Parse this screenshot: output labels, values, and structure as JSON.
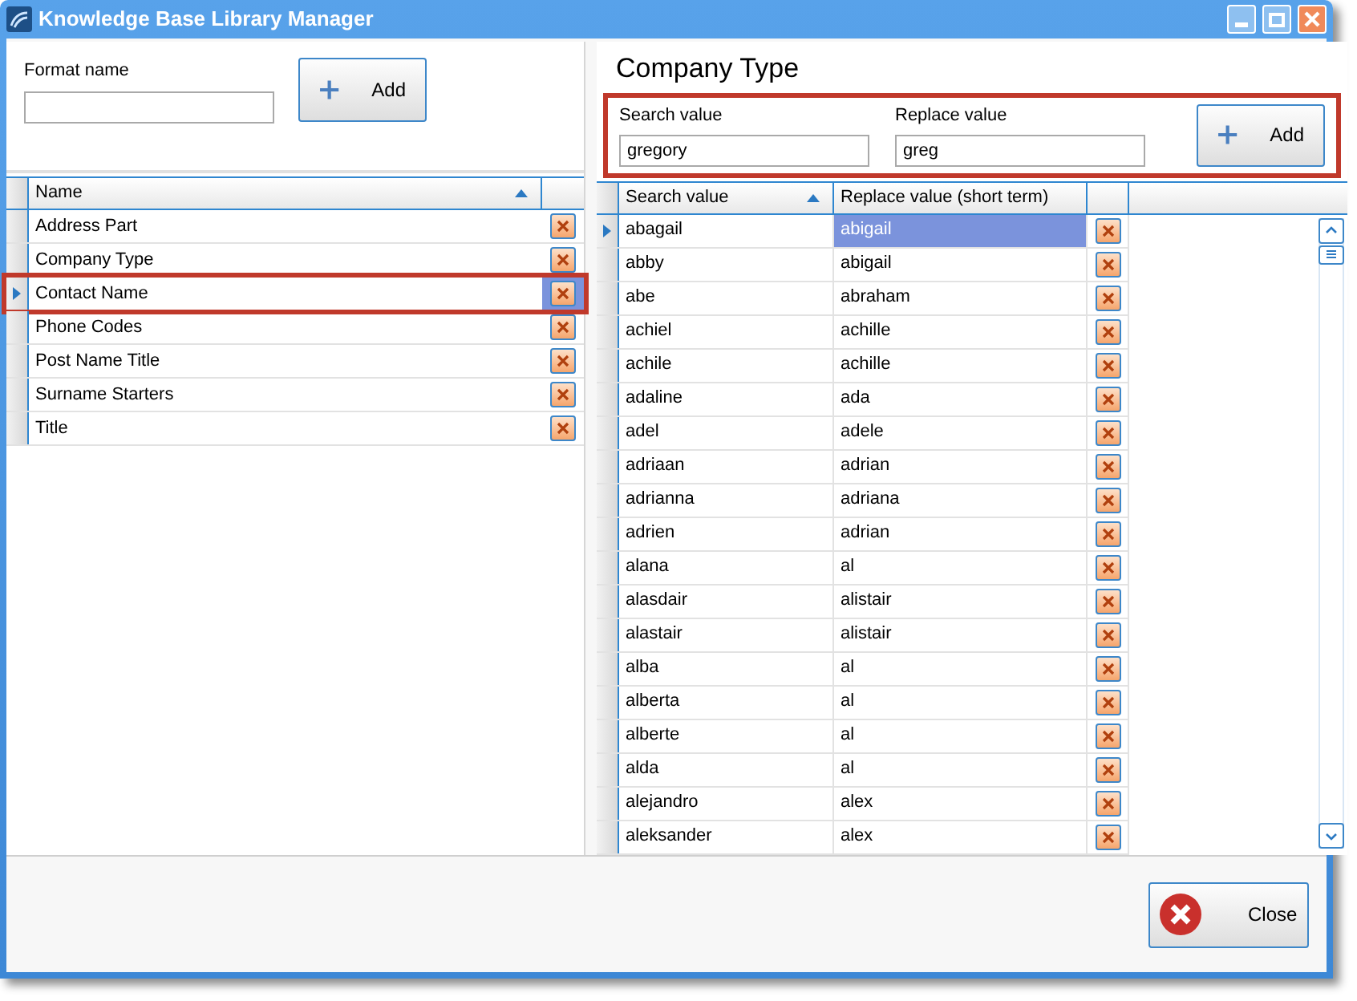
{
  "window": {
    "title": "Knowledge Base Library Manager"
  },
  "format_form": {
    "label": "Format name",
    "add_button": "Add"
  },
  "formats_table": {
    "columns": [
      "Name"
    ],
    "sorted": true,
    "rows": [
      {
        "name": "Address Part",
        "selected": false,
        "highlighted": false
      },
      {
        "name": "Company Type",
        "selected": false,
        "highlighted": false
      },
      {
        "name": "Contact Name",
        "selected": true,
        "highlighted": true
      },
      {
        "name": "Phone Codes",
        "selected": false,
        "highlighted": false
      },
      {
        "name": "Post Name Title",
        "selected": false,
        "highlighted": false
      },
      {
        "name": "Surname Starters",
        "selected": false,
        "highlighted": false
      },
      {
        "name": "Title",
        "selected": false,
        "highlighted": false
      }
    ]
  },
  "detail": {
    "heading": "Company Type",
    "entry": {
      "highlighted": true,
      "search_label": "Search value",
      "search_value": "gregory",
      "replace_label": "Replace value",
      "replace_value": "greg",
      "add_button": "Add"
    },
    "table": {
      "columns": [
        "Search value",
        "Replace value (short term)"
      ],
      "sorted": true,
      "rows": [
        {
          "search": "abagail",
          "replace": "abigail",
          "selected": true
        },
        {
          "search": "abby",
          "replace": "abigail",
          "selected": false
        },
        {
          "search": "abe",
          "replace": "abraham",
          "selected": false
        },
        {
          "search": "achiel",
          "replace": "achille",
          "selected": false
        },
        {
          "search": "achile",
          "replace": "achille",
          "selected": false
        },
        {
          "search": "adaline",
          "replace": "ada",
          "selected": false
        },
        {
          "search": "adel",
          "replace": "adele",
          "selected": false
        },
        {
          "search": "adriaan",
          "replace": "adrian",
          "selected": false
        },
        {
          "search": "adrianna",
          "replace": "adriana",
          "selected": false
        },
        {
          "search": "adrien",
          "replace": "adrian",
          "selected": false
        },
        {
          "search": "alana",
          "replace": "al",
          "selected": false
        },
        {
          "search": "alasdair",
          "replace": "alistair",
          "selected": false
        },
        {
          "search": "alastair",
          "replace": "alistair",
          "selected": false
        },
        {
          "search": "alba",
          "replace": "al",
          "selected": false
        },
        {
          "search": "alberta",
          "replace": "al",
          "selected": false
        },
        {
          "search": "alberte",
          "replace": "al",
          "selected": false
        },
        {
          "search": "alda",
          "replace": "al",
          "selected": false
        },
        {
          "search": "alejandro",
          "replace": "alex",
          "selected": false
        },
        {
          "search": "aleksander",
          "replace": "alex",
          "selected": false
        }
      ]
    }
  },
  "close_button": "Close"
}
